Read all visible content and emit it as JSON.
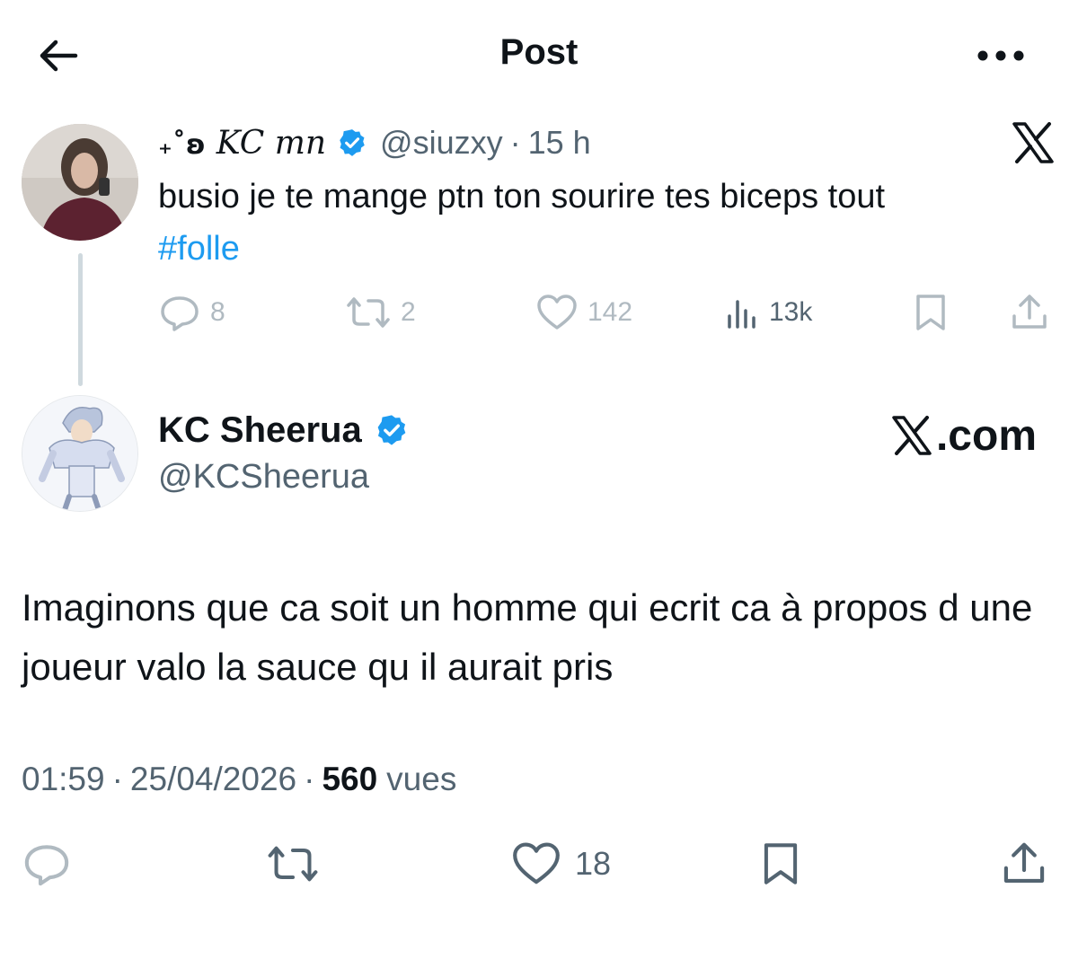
{
  "header": {
    "title": "Post"
  },
  "reply": {
    "name_symbols": "₊˚ʚ",
    "display_name": "KC mn",
    "handle": "@siuzxy",
    "separator": "·",
    "time": "15 h",
    "text_main": "busio je te mange ptn ton sourire tes biceps tout ",
    "hashtag": "#folle",
    "counts": {
      "replies": "8",
      "reposts": "2",
      "likes": "142",
      "views": "13k"
    }
  },
  "tweet": {
    "display_name": "KC Sheerua",
    "handle": "@KCSheerua",
    "watermark_suffix": ".com",
    "text": "Imaginons que ca soit un homme qui ecrit ca à propos d une joueur valo la sauce qu il aurait pris",
    "time": "01:59",
    "date": "25/04/2026",
    "separator": "·",
    "views_count": "560",
    "views_label": "vues",
    "counts": {
      "likes": "18"
    }
  },
  "colors": {
    "accent": "#1d9bf0",
    "text": "#0f1419",
    "muted": "#536471",
    "faded": "#b0bac1"
  },
  "icons": [
    "back-arrow-icon",
    "more-icon",
    "verified-badge-icon",
    "x-logo-icon",
    "reply-icon",
    "repost-icon",
    "like-icon",
    "views-icon",
    "bookmark-icon",
    "share-icon"
  ]
}
